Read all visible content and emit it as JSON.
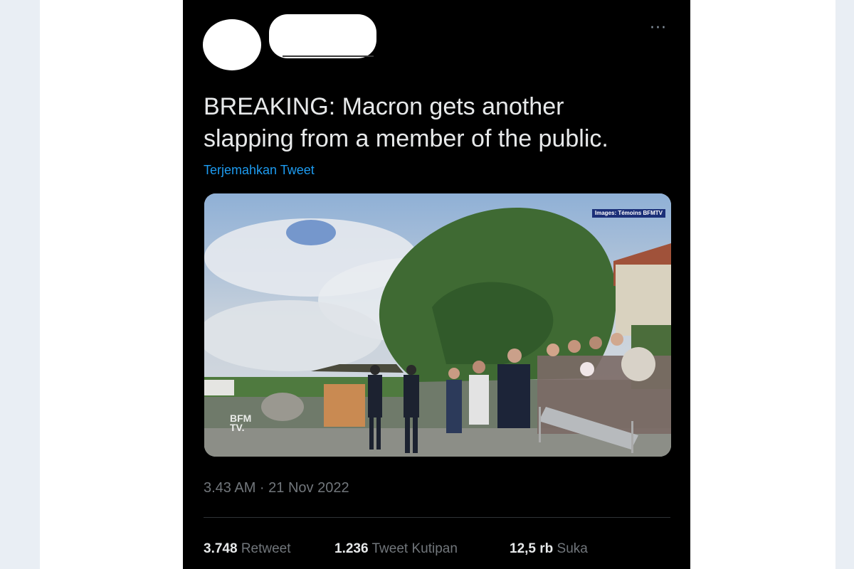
{
  "tweet": {
    "text_line1": "BREAKING: Macron gets another",
    "text_line2": "slapping from a member of the public.",
    "translate_label": "Terjemahkan Tweet",
    "more_icon": "more-horizontal-icon",
    "more_glyph": "···",
    "timestamp": "3.43 AM · 21 Nov 2022"
  },
  "media": {
    "credit": "Images: Témoins BFMTV",
    "logo_line1": "BFM",
    "logo_line2": "TV."
  },
  "stats": [
    {
      "value": "3.748",
      "label": "Retweet"
    },
    {
      "value": "1.236",
      "label": "Tweet Kutipan"
    },
    {
      "value": "12,5 rb",
      "label": "Suka"
    }
  ],
  "colors": {
    "background": "#000000",
    "text": "#e7e9ea",
    "secondary": "#71767b",
    "link": "#1d9bf0"
  }
}
